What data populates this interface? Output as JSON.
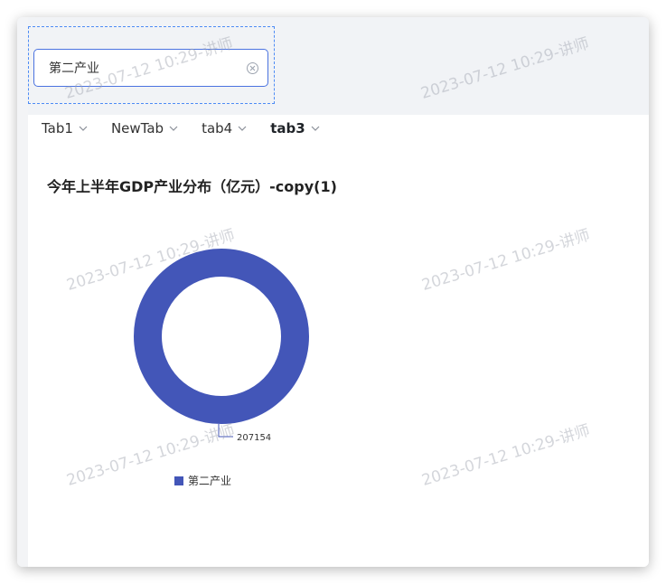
{
  "filter": {
    "value": "第二产业"
  },
  "tabs": [
    {
      "label": "Tab1",
      "active": false
    },
    {
      "label": "NewTab",
      "active": false
    },
    {
      "label": "tab4",
      "active": false
    },
    {
      "label": "tab3",
      "active": true
    }
  ],
  "chart_data": {
    "type": "pie",
    "title": "今年上半年GDP产业分布（亿元）-copy(1)",
    "style": "donut",
    "slices": [
      {
        "label": "第二产业",
        "value": 207154,
        "color": "#4356b8"
      }
    ],
    "legend": {
      "position": "bottom",
      "entries": [
        "第二产业"
      ]
    }
  },
  "watermark": {
    "text": "2023-07-12 10:29-讲师"
  },
  "colors": {
    "accent": "#4b73e0",
    "series": "#4356b8"
  }
}
